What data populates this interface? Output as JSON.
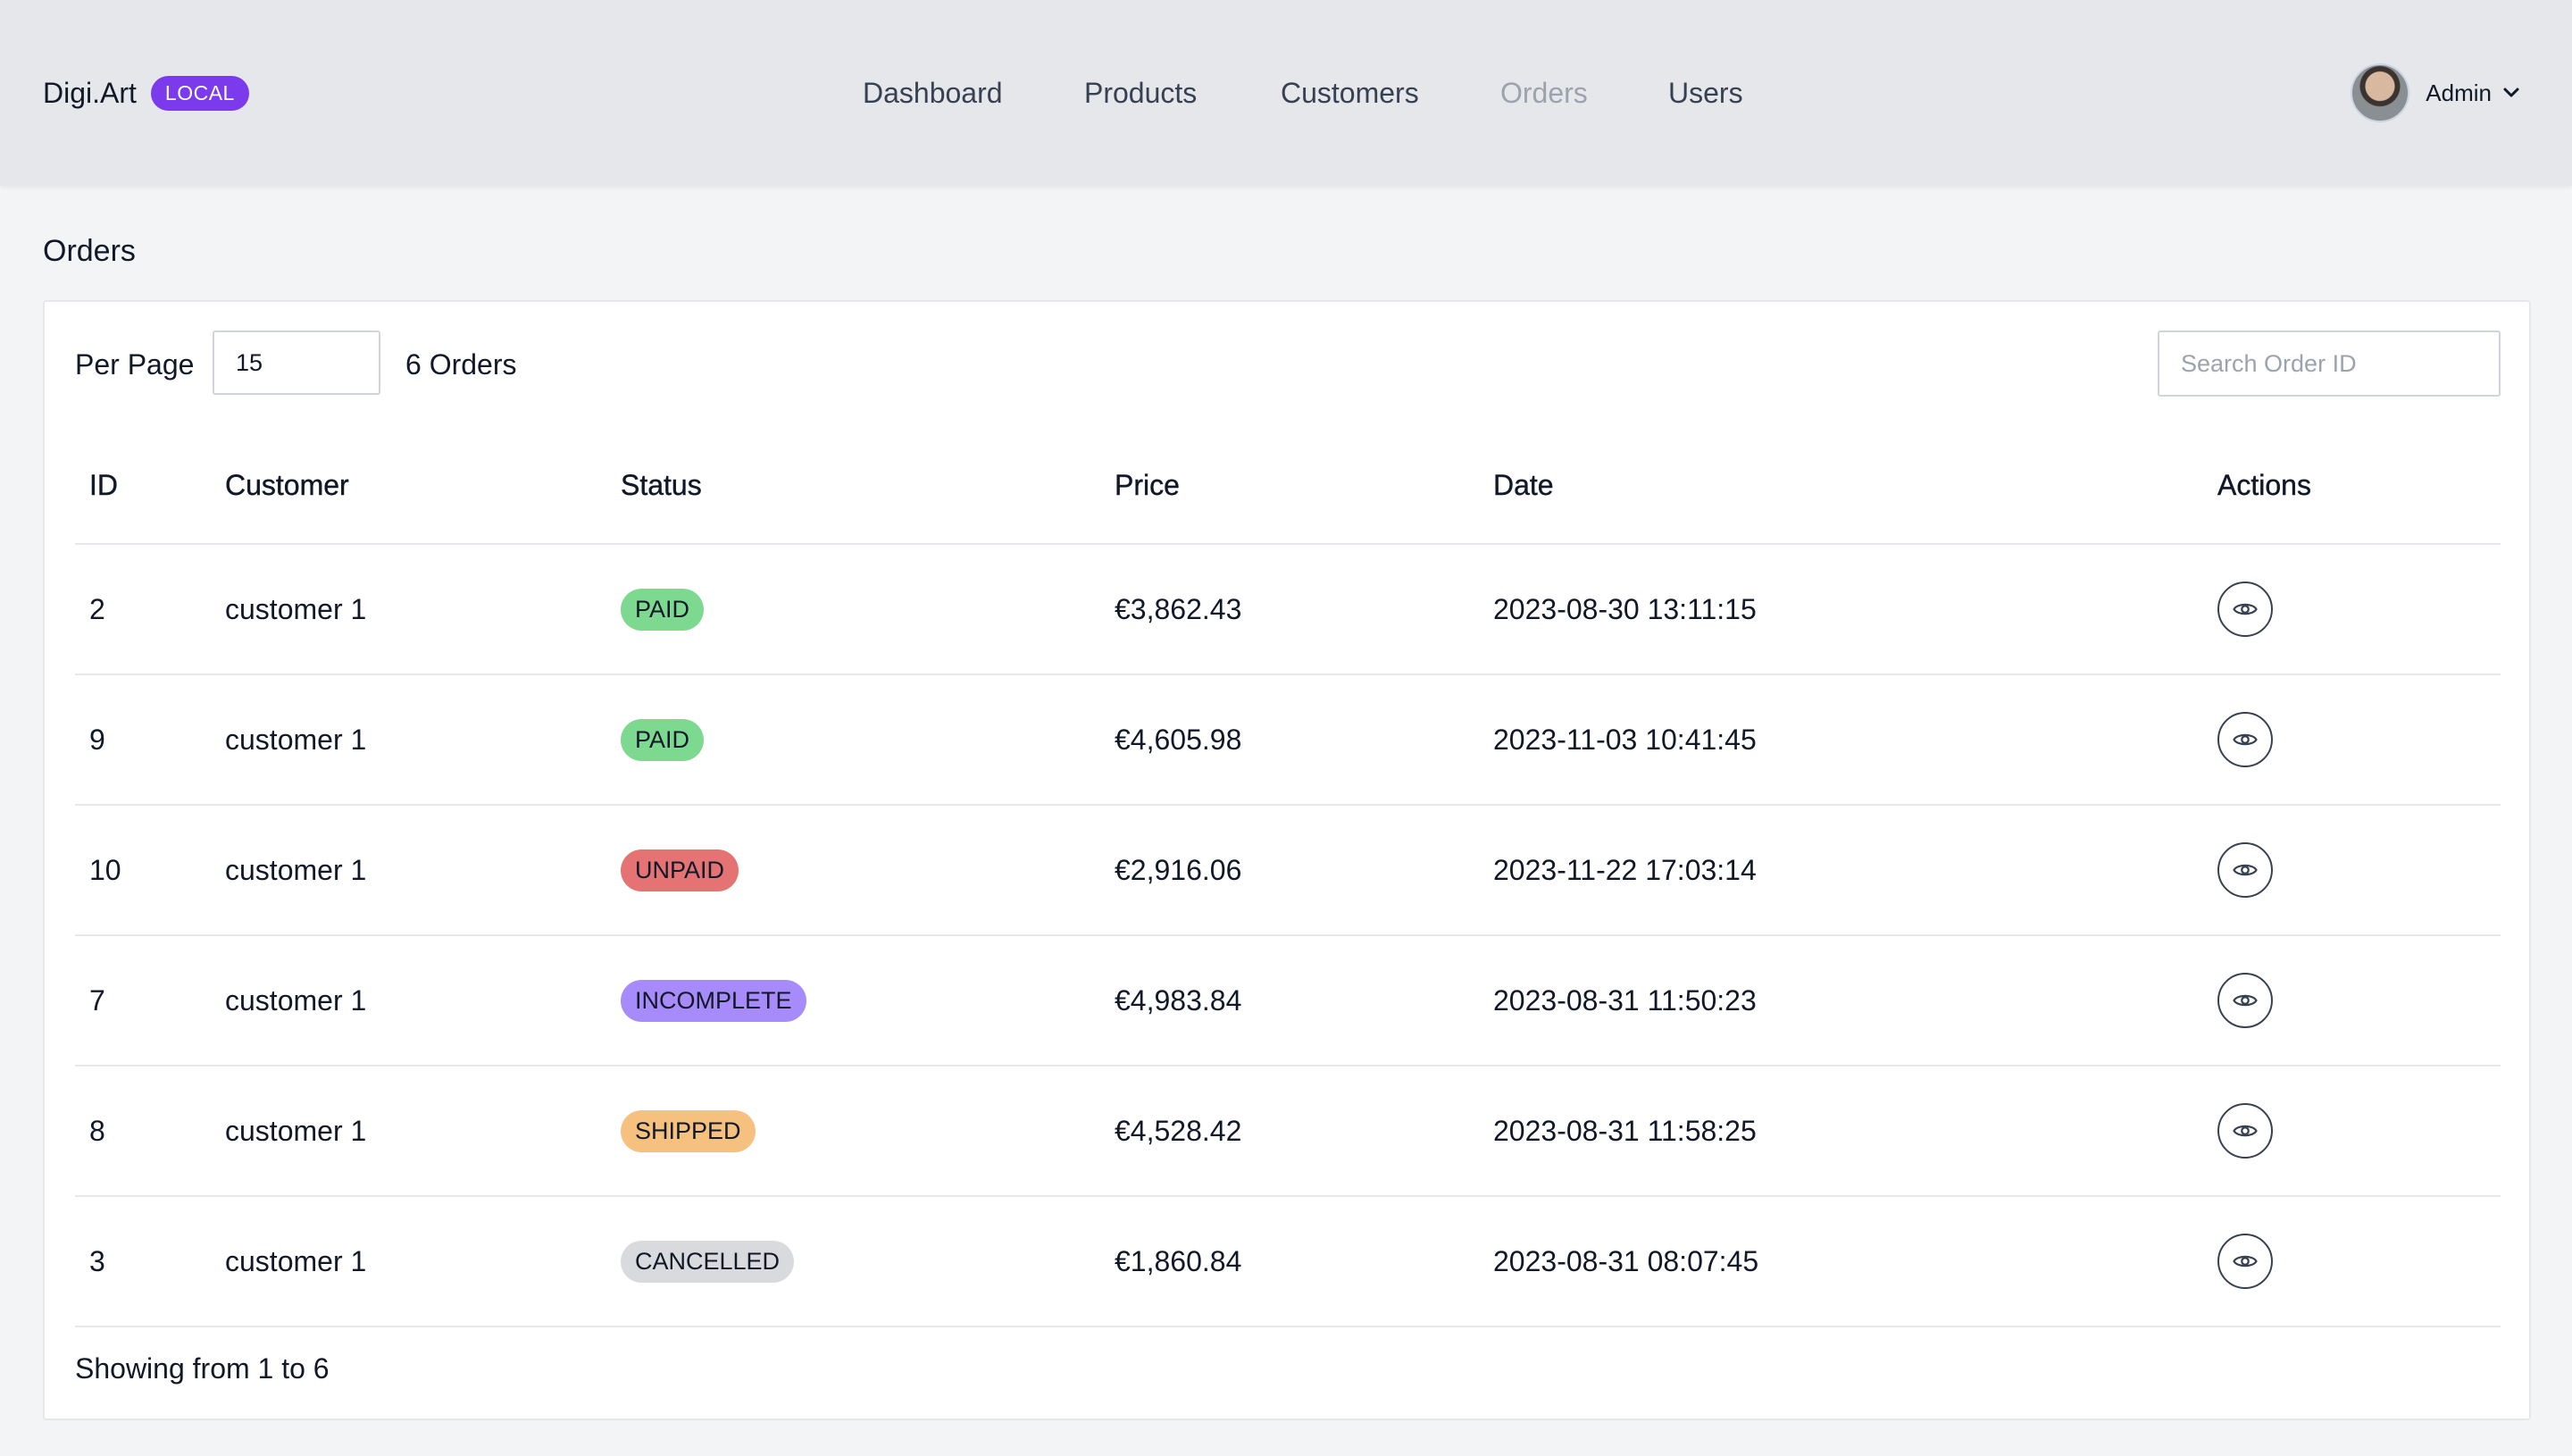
{
  "app": {
    "name": "Digi.Art",
    "env_badge": "LOCAL"
  },
  "nav": {
    "items": [
      {
        "label": "Dashboard"
      },
      {
        "label": "Products"
      },
      {
        "label": "Customers"
      },
      {
        "label": "Orders"
      },
      {
        "label": "Users"
      }
    ]
  },
  "user": {
    "name": "Admin"
  },
  "page": {
    "title": "Orders"
  },
  "toolbar": {
    "per_page_label": "Per Page",
    "per_page_value": "15",
    "count_text": "6 Orders",
    "search_placeholder": "Search Order ID"
  },
  "table": {
    "headers": {
      "id": "ID",
      "customer": "Customer",
      "status": "Status",
      "price": "Price",
      "date": "Date",
      "actions": "Actions"
    },
    "rows": [
      {
        "id": "2",
        "customer": "customer 1",
        "status": "PAID",
        "price": "€3,862.43",
        "date": "2023-08-30 13:11:15"
      },
      {
        "id": "9",
        "customer": "customer 1",
        "status": "PAID",
        "price": "€4,605.98",
        "date": "2023-11-03 10:41:45"
      },
      {
        "id": "10",
        "customer": "customer 1",
        "status": "UNPAID",
        "price": "€2,916.06",
        "date": "2023-11-22 17:03:14"
      },
      {
        "id": "7",
        "customer": "customer 1",
        "status": "INCOMPLETE",
        "price": "€4,983.84",
        "date": "2023-08-31 11:50:23"
      },
      {
        "id": "8",
        "customer": "customer 1",
        "status": "SHIPPED",
        "price": "€4,528.42",
        "date": "2023-08-31 11:58:25"
      },
      {
        "id": "3",
        "customer": "customer 1",
        "status": "CANCELLED",
        "price": "€1,860.84",
        "date": "2023-08-31 08:07:45"
      }
    ]
  },
  "status_colors": {
    "PAID": "#7dd98f",
    "UNPAID": "#e57373",
    "INCOMPLETE": "#a78bfa",
    "SHIPPED": "#f6c07f",
    "CANCELLED": "#d9dadd"
  },
  "footer": {
    "text": "Showing from 1 to 6"
  }
}
